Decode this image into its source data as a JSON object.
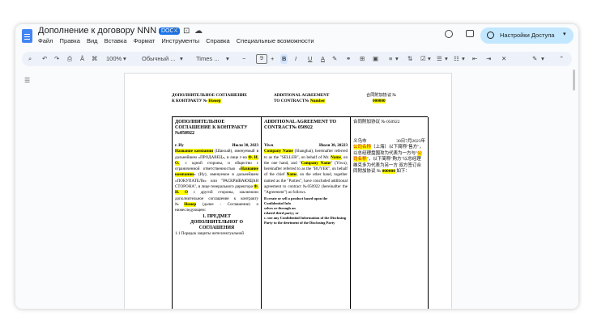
{
  "app": {
    "title": "Дополнение к договору NNN",
    "badge": "DOCX",
    "menu": [
      "Файл",
      "Правка",
      "Вид",
      "Вставка",
      "Формат",
      "Инструменты",
      "Справка",
      "Специальные возможности"
    ],
    "share_label": "Настройки Доступа"
  },
  "toolbar": {
    "zoom": "100%",
    "style": "Обычный ...",
    "font": "Times ...",
    "font_size": "9",
    "minus": "−",
    "plus": "+",
    "bold": "B",
    "italic": "I",
    "underline": "U",
    "text_color": "A"
  },
  "document": {
    "header": {
      "ru_line1": "ДОПОЛНИТЕЛЬНОЕ СОГЛАШЕНИЕ",
      "ru_line2_prefix": "К КОНТРАКТУ № ",
      "ru_line2_hl": "Номер",
      "en_line1": "ADDITIONAL AGREEMENT",
      "en_line2_prefix": "TO CONTRACT№ ",
      "en_line2_hl": "Number",
      "cn_line1": "合同附加协议 №",
      "cn_line2_hl": "000000"
    },
    "ru_col": {
      "title": "ДОПОЛНИТЕЛЬНОЕ СОГЛАШЕНИЕ К КОНТРАКТУ №050922",
      "city": "г. Иу",
      "date": "Июля 30, 2023",
      "company_hl": "Название компании",
      "p1": "(Шанхай), именуемый в дальнейшем «ПРОДАВЕЦ», в лице г-на",
      "fio_hl": "Ф. И. О.",
      "p2": ", с одной стороны, и общество с ограниченной ответственностью «",
      "company2_hl": "Название компании",
      "p3": "» (Иу), именуемое в дальнейшем «ПОКУПАТЕЛЬ» или \"РАСКРЫВАЮЩАЯ СТОРОНА\", в лице генерального директора",
      "fio2_hl": "Ф. И. О",
      "p4": "с другой стороны, заключили дополнительное соглашение к контракту №",
      "num_hl": "Номер",
      "p5": "(далее - Соглашение) о нижеследующем:",
      "section": "1. ПРЕДМЕТ ДОПОЛНИТЕЛЬНОГ О СОГЛАШЕНИЯ",
      "p6": "1.1 Порядок защиты интеллектуальной"
    },
    "en_col": {
      "title": "ADDITIONAL AGREEMENT TO CONTRACT№ 050922",
      "city": "Yiwu",
      "date": "Июля 30, 20223",
      "company_hl": "Company Name",
      "p1": "(Shanghai), hereinafter referred to as the \"SELLER\", on behalf of Mr.",
      "name_hl": "Name",
      "p2": ", on the one hand, and \"",
      "company2_hl": "Company Name",
      "p3": "\" (Yiwu), hereinafter referred to as the \"BUYER\", on behalf of the chief",
      "name2_hl": "Name",
      "p4": ", on the other hand, together named as the \"Parties\", have concluded additional agreement to contract №050922 (hereinafter the \"Agreement\") as follows.",
      "b1": "B create or sell a product based upon the",
      "b2": "Confidential Info",
      "b3": "selves or through an",
      "b4": "related third party; or",
      "b5": "c. use any Confidential Information of the Disclosing Party to the detriment of the Disclosing Party"
    },
    "cn_col": {
      "title": "合同附加协议 № 050922",
      "city": "义乌市",
      "date": "30日7月2023年",
      "company_hl": "公司名称",
      "p1": "（上海）以下简称\"售方\"，以总经理盘围攻为代表为一方与\"",
      "company2_hl": "公司名称",
      "p2": "\"，以下简称\"购方\"以总经理维克多为代表为另一方 双方签订合同附加协议 №",
      "num_hl": "000000",
      "p3": "如下："
    }
  }
}
